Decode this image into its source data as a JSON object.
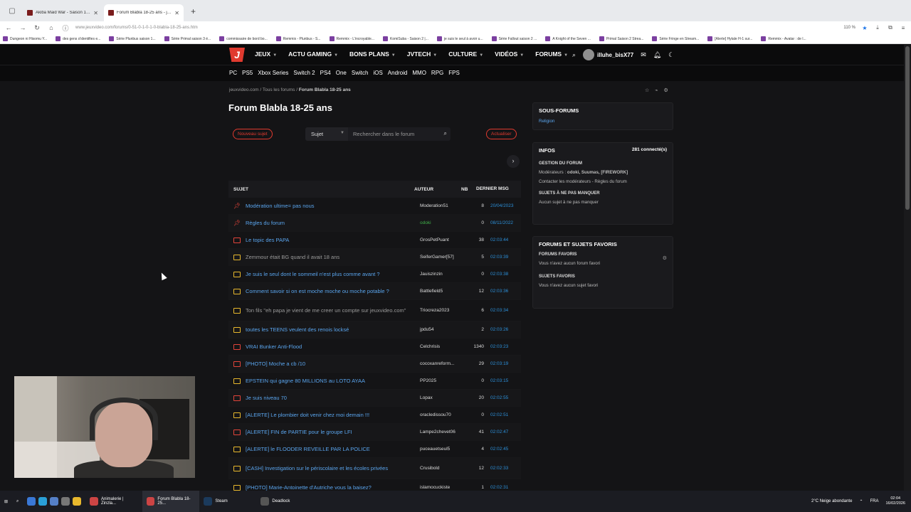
{
  "browser": {
    "tabs": [
      {
        "title": "Akiba Maid War - Saison 1 | An"
      },
      {
        "title": "Forum Blabla 18-25 ans - jeuxv"
      }
    ],
    "url": "www.jeuxvideo.com/forums/0-51-0-1-0-1-0-blabla-18-25-ans.htm",
    "zoom": "110 %",
    "bookmarks": [
      "Dungeon ni Hisomu Y...",
      "des gens s'identifies e...",
      "Série Plunbus saison 1...",
      "Série Primal saison 3 é...",
      "commissaire de bord bo...",
      "Remmix - Plunbus - S...",
      "Remmix - L'incroyable...",
      "KomiSuba - Saison 2 |...",
      "je suis le seul à avoir u...",
      "Série Fallout saison 2 ...",
      "A Knight of the Seven ...",
      "Primal Saison 2 Strea...",
      "Série Fringe en Stream...",
      "[Alerte] Hytale H-1 sur...",
      "Remmix - Avatar : de l..."
    ]
  },
  "site": {
    "logo": "J",
    "menu": [
      "JEUX",
      "ACTU GAMING",
      "BONS PLANS",
      "JVTECH",
      "CULTURE",
      "VIDÉOS",
      "FORUMS"
    ],
    "username": "illuhe_bisX77",
    "subnav": [
      "PC",
      "PS5",
      "Xbox Series",
      "Switch 2",
      "PS4",
      "One",
      "Switch",
      "iOS",
      "Android",
      "MMO",
      "RPG",
      "FPS"
    ],
    "breadcrumb": {
      "a": "jeuxvideo.com",
      "b": "Tous les forums",
      "c": "Forum Blabla 18-25 ans"
    },
    "title": "Forum Blabla 18-25 ans",
    "toolbar": {
      "new_topic": "Nouveau sujet",
      "select": "Sujet",
      "search_placeholder": "Rechercher dans le forum",
      "refresh": "Actualiser"
    },
    "table": {
      "headers": {
        "subject": "SUJET",
        "author": "AUTEUR",
        "nb": "NB",
        "last": "DERNIER MSG"
      },
      "rows": [
        {
          "subject": "Modération ultime= pas nous",
          "author": "Moderation51",
          "nb": "8",
          "date": "20/04/2023",
          "icon": "pin"
        },
        {
          "subject": "Règles du forum",
          "author": "odoki",
          "nb": "0",
          "date": "08/11/2022",
          "icon": "pin"
        },
        {
          "subject": "Le topic des PAPA",
          "author": "GrosPetPuant",
          "nb": "38",
          "date": "02:03:44",
          "icon": "red"
        },
        {
          "subject": "Zemmour était BG quand il avait 18 ans",
          "author": "SeiferGamer[57]",
          "nb": "5",
          "date": "02:03:39",
          "icon": "yellow"
        },
        {
          "subject": "Je suis le seul dont le sommeil n'est plus comme avant ?",
          "author": "Jauiszinzin",
          "nb": "0",
          "date": "02:03:38",
          "icon": "yellow"
        },
        {
          "subject": "Comment savoir si on est moche moche ou moche potable ?",
          "author": "Battlefield5",
          "nb": "12",
          "date": "02:03:36",
          "icon": "yellow"
        },
        {
          "subject": "Ton fils \"eh papa je vient de me creer un compte sur jeuxvideo.com\"",
          "author": "Triocreza2023",
          "nb": "6",
          "date": "02:03:34",
          "icon": "yellow"
        },
        {
          "subject": "toutes les TEENS veulent des renois locksé",
          "author": "jpdu54",
          "nb": "2",
          "date": "02:03:26",
          "icon": "yellow"
        },
        {
          "subject": "VRAI Bunker Anti-Flood",
          "author": "Celchrisis",
          "nb": "1340",
          "date": "02:03:23",
          "icon": "red"
        },
        {
          "subject": "[PHOTO] Moche a cb /10",
          "author": "cocoxanreform...",
          "nb": "29",
          "date": "02:03:19",
          "icon": "red"
        },
        {
          "subject": "EPSTEIN qui gagne 80 MILLIONS au LOTO AYAA",
          "author": "PP2025",
          "nb": "0",
          "date": "02:03:15",
          "icon": "yellow"
        },
        {
          "subject": "Je suis niveau 70",
          "author": "Lopax",
          "nb": "20",
          "date": "02:02:55",
          "icon": "red"
        },
        {
          "subject": "[ALERTE] Le plombier doit venir chez moi demain !!!",
          "author": "oracledissou70",
          "nb": "0",
          "date": "02:02:51",
          "icon": "yellow"
        },
        {
          "subject": "[ALERTE] FIN de PARTIE pour le groupe LFI",
          "author": "Lampe2chevet06",
          "nb": "41",
          "date": "02:02:47",
          "icon": "red"
        },
        {
          "subject": "[ALERTE] le FLOODER REVEILLE PAR LA POLICE",
          "author": "puceauetseul5",
          "nb": "4",
          "date": "02:02:45",
          "icon": "yellow"
        },
        {
          "subject": "[CASH] Investigation sur le périscolaire et les écoles privées",
          "author": "Crusibold",
          "nb": "12",
          "date": "02:02:33",
          "icon": "yellow"
        },
        {
          "subject": "[PHOTO] Marie-Antoinette d'Autriche vous la baisez?",
          "author": "islamocuckiste",
          "nb": "1",
          "date": "02:02:31",
          "icon": "yellow"
        }
      ]
    },
    "side": {
      "subforums_title": "SOUS-FORUMS",
      "subforums_item": "Religion",
      "infos_title": "INFOS",
      "connected": "281 connecté(s)",
      "gestion": "GESTION DU FORUM",
      "mods_label": "Modérateurs :",
      "mods": "odoki, Suumas, [FIREWORK]",
      "contact": "Contacter les modérateurs - Règles du forum",
      "notmiss": "SUJETS À NE PAS MANQUER",
      "notmiss_text": "Aucun sujet à ne pas manquer",
      "fav_title": "FORUMS ET SUJETS FAVORIS",
      "fav_forums": "FORUMS FAVORIS",
      "fav_forums_text": "Vous n'avez aucun forum favori",
      "fav_topics": "SUJETS FAVORIS",
      "fav_topics_text": "Vous n'avez aucun sujet favori"
    }
  },
  "taskbar": {
    "apps": [
      "Animalerie | Zinzla...",
      "Forum Blabla 18-25...",
      "Steam",
      "Deadlock"
    ],
    "weather": "2°C  Neige abondante",
    "lang": "FRA",
    "time": "02:04",
    "date": "16/02/2026"
  }
}
